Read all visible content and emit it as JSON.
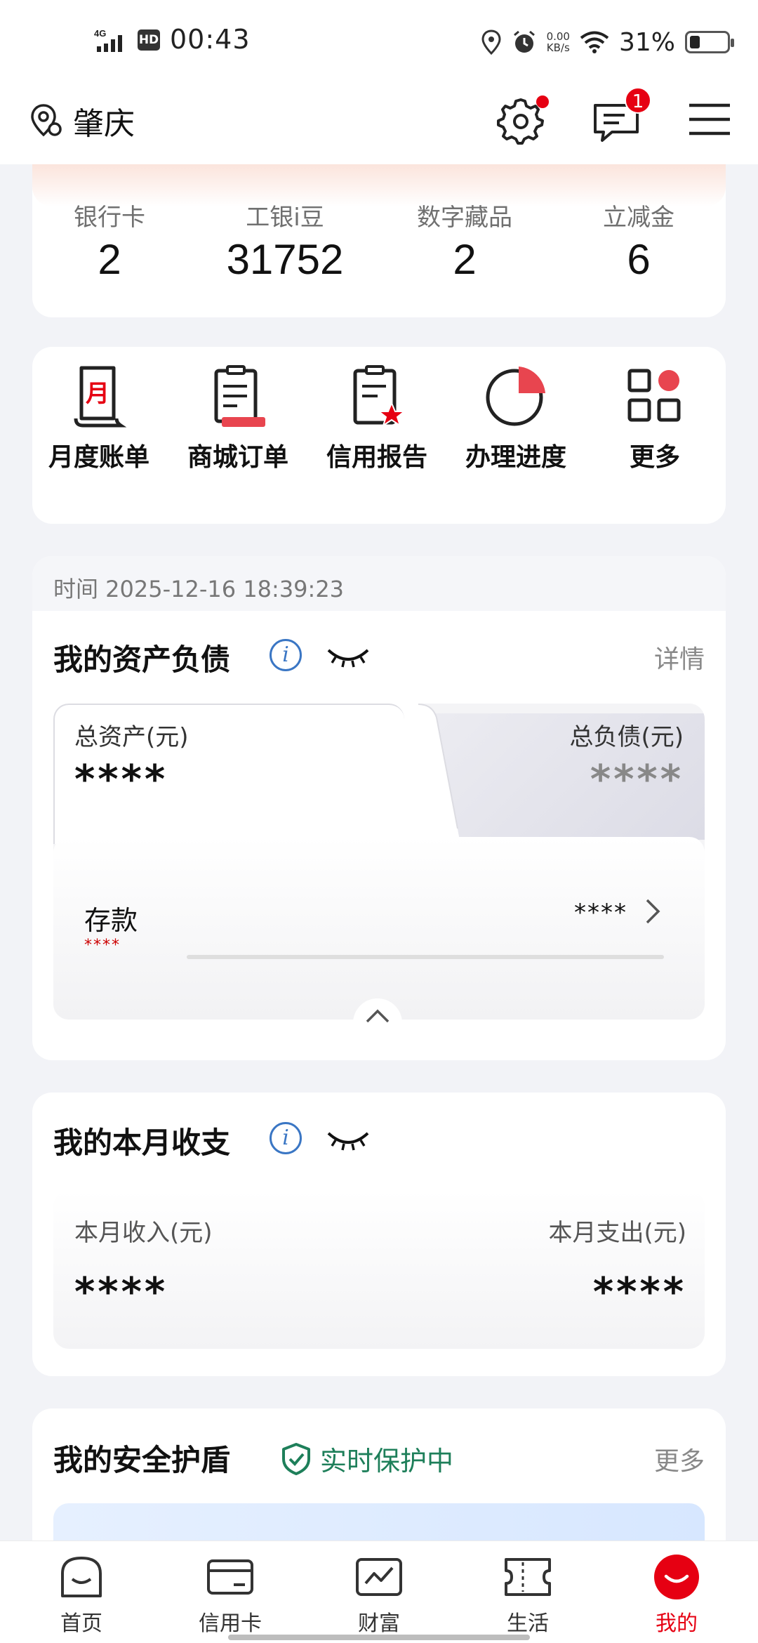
{
  "status_bar": {
    "network": "4G",
    "hd": "HD",
    "time": "00:43",
    "speed_value": "0.00",
    "speed_unit": "KB/s",
    "battery": "31%"
  },
  "header": {
    "city": "肇庆",
    "settings_icon": "gear-icon",
    "message_badge": "1",
    "menu_icon": "hamburger-icon"
  },
  "summary": {
    "stats": [
      {
        "label": "银行卡",
        "value": "2"
      },
      {
        "label": "工银i豆",
        "value": "31752"
      },
      {
        "label": "数字藏品",
        "value": "2"
      },
      {
        "label": "立减金",
        "value": "6"
      }
    ]
  },
  "quick_actions": [
    {
      "label": "月度账单",
      "icon": "monthly-bill-icon",
      "glyph": "月"
    },
    {
      "label": "商城订单",
      "icon": "mall-order-icon"
    },
    {
      "label": "信用报告",
      "icon": "credit-report-icon"
    },
    {
      "label": "办理进度",
      "icon": "progress-pie-icon"
    },
    {
      "label": "更多",
      "icon": "more-grid-icon"
    }
  ],
  "assets": {
    "timestamp": "时间 2025-12-16 18:39:23",
    "title": "我的资产负债",
    "detail_link": "详情",
    "total_assets_label": "总资产(元)",
    "total_assets_value": "****",
    "total_liabilities_label": "总负债(元)",
    "total_liabilities_value": "****",
    "deposit_label": "存款",
    "deposit_sub": "****",
    "deposit_value": "****"
  },
  "income": {
    "title": "我的本月收支",
    "income_label": "本月收入(元)",
    "income_value": "****",
    "expense_label": "本月支出(元)",
    "expense_value": "****"
  },
  "security": {
    "title": "我的安全护盾",
    "status": "实时保护中",
    "more_link": "更多"
  },
  "bottom_nav": [
    {
      "label": "首页",
      "icon": "home-smile-icon",
      "active": false
    },
    {
      "label": "信用卡",
      "icon": "credit-card-icon",
      "active": false
    },
    {
      "label": "财富",
      "icon": "wealth-chart-icon",
      "active": false
    },
    {
      "label": "生活",
      "icon": "ticket-icon",
      "active": false
    },
    {
      "label": "我的",
      "icon": "profile-smile-icon",
      "active": true
    }
  ],
  "colors": {
    "brand_red": "#e60012",
    "security_green": "#1e7f5a",
    "info_blue": "#3a76c4"
  }
}
